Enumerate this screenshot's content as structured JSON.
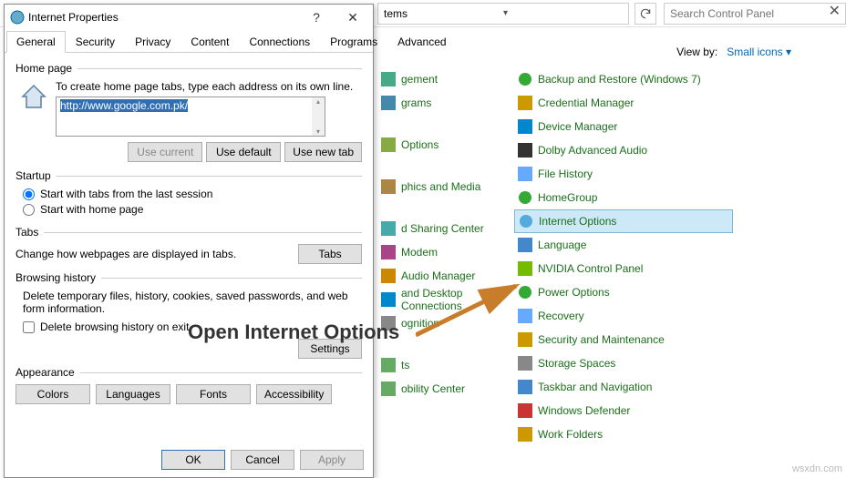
{
  "dialog": {
    "title": "Internet Properties",
    "tabs": [
      "General",
      "Security",
      "Privacy",
      "Content",
      "Connections",
      "Programs",
      "Advanced"
    ],
    "homepage": {
      "legend": "Home page",
      "desc": "To create home page tabs, type each address on its own line.",
      "url": "http://www.google.com.pk/",
      "btn_current": "Use current",
      "btn_default": "Use default",
      "btn_newtab": "Use new tab"
    },
    "startup": {
      "legend": "Startup",
      "opt1": "Start with tabs from the last session",
      "opt2": "Start with home page"
    },
    "tabs_section": {
      "legend": "Tabs",
      "desc": "Change how webpages are displayed in tabs.",
      "btn": "Tabs"
    },
    "history": {
      "legend": "Browsing history",
      "desc": "Delete temporary files, history, cookies, saved passwords, and web form information.",
      "chk": "Delete browsing history on exit",
      "btn_settings": "Settings"
    },
    "appearance": {
      "legend": "Appearance",
      "btn_colors": "Colors",
      "btn_lang": "Languages",
      "btn_fonts": "Fonts",
      "btn_access": "Accessibility"
    },
    "footer": {
      "ok": "OK",
      "cancel": "Cancel",
      "apply": "Apply"
    }
  },
  "cp": {
    "location_suffix": "tems",
    "search_placeholder": "Search Control Panel",
    "view_label": "View by:",
    "view_value": "Small icons ▾",
    "col1": [
      "gement",
      "grams",
      "Options",
      "phics and Media",
      "d Sharing Center",
      "Modem",
      "Audio Manager",
      "and Desktop Connections",
      "ognition",
      "ts",
      "obility Center"
    ],
    "col2": [
      "Backup and Restore (Windows 7)",
      "Credential Manager",
      "Device Manager",
      "Dolby Advanced Audio",
      "File History",
      "HomeGroup",
      "Internet Options",
      "Language",
      "NVIDIA Control Panel",
      "Power Options",
      "Recovery",
      "Security and Maintenance",
      "Storage Spaces",
      "Taskbar and Navigation",
      "Windows Defender",
      "Work Folders"
    ]
  },
  "overlay": "Open Internet Options",
  "watermark": "wsxdn.com"
}
